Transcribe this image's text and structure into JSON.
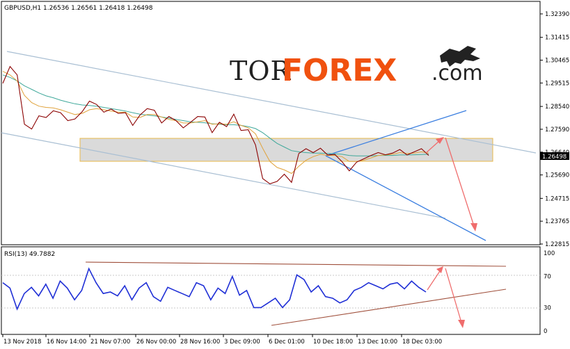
{
  "chart_data": [
    {
      "type": "line",
      "kind": "candlestick-price",
      "symbol": "GBPUSD,H1",
      "ohlc": {
        "open": "1.26536",
        "high": "1.26561",
        "low": "1.26418",
        "close": "1.26498"
      },
      "current_price_label": "1.26498",
      "y_ticks": [
        "1.32390",
        "1.31415",
        "1.30465",
        "1.29515",
        "1.28540",
        "1.27590",
        "1.26640",
        "1.25690",
        "1.24715",
        "1.23765",
        "1.22815"
      ],
      "ylim": [
        1.22815,
        1.3239
      ],
      "x_ticks": [
        "13 Nov 2018",
        "16 Nov 14:00",
        "21 Nov 07:00",
        "26 Nov 00:00",
        "28 Nov 16:00",
        "3 Dec 09:00",
        "6 Dec 01:00",
        "10 Dec 18:00",
        "13 Dec 10:00",
        "18 Dec 03:00"
      ],
      "grid": false,
      "series": [
        {
          "values": [
            1.295,
            1.302,
            1.2985,
            1.278,
            1.276,
            1.2815,
            1.2808,
            1.2836,
            1.2828,
            1.2795,
            1.2802,
            1.2832,
            1.2876,
            1.2862,
            1.283,
            1.2843,
            1.2825,
            1.2828,
            1.2775,
            1.2818,
            1.2845,
            1.2838,
            1.2785,
            1.2812,
            1.2795,
            1.2765,
            1.2788,
            1.2812,
            1.281,
            1.2745,
            1.2788,
            1.277,
            1.2822,
            1.2754,
            1.2757,
            1.2694,
            1.2554,
            1.2532,
            1.2542,
            1.2572,
            1.2538,
            1.2658,
            1.2678,
            1.2662,
            1.268,
            1.2652,
            1.2654,
            1.2624,
            1.2586,
            1.2622,
            1.2636,
            1.265,
            1.2662,
            1.2653,
            1.266,
            1.2675,
            1.2652,
            1.2665,
            1.2678,
            1.265
          ]
        },
        {
          "values": [
            1.3,
            1.2985,
            1.296,
            1.29,
            1.287,
            1.2855,
            1.285,
            1.2848,
            1.284,
            1.283,
            1.282,
            1.2825,
            1.284,
            1.2845,
            1.284,
            1.2835,
            1.283,
            1.283,
            1.281,
            1.2808,
            1.282,
            1.282,
            1.281,
            1.28,
            1.2795,
            1.2785,
            1.2785,
            1.279,
            1.2795,
            1.278,
            1.2782,
            1.278,
            1.279,
            1.2775,
            1.2765,
            1.274,
            1.268,
            1.2625,
            1.26,
            1.259,
            1.2575,
            1.2605,
            1.263,
            1.2645,
            1.2655,
            1.265,
            1.265,
            1.2645,
            1.2625,
            1.2625,
            1.263,
            1.264,
            1.265,
            1.2652,
            1.2655,
            1.2662,
            1.2658,
            1.266,
            1.2665,
            1.266
          ]
        },
        {
          "values": [
            1.2985,
            1.2975,
            1.296,
            1.294,
            1.2925,
            1.291,
            1.2898,
            1.289,
            1.288,
            1.2872,
            1.2865,
            1.286,
            1.2858,
            1.2855,
            1.285,
            1.2845,
            1.284,
            1.2835,
            1.2828,
            1.2822,
            1.2818,
            1.2815,
            1.281,
            1.2805,
            1.28,
            1.2795,
            1.279,
            1.2788,
            1.2786,
            1.2782,
            1.278,
            1.2778,
            1.2778,
            1.2775,
            1.277,
            1.2762,
            1.2745,
            1.2722,
            1.27,
            1.2685,
            1.267,
            1.2665,
            1.2662,
            1.266,
            1.266,
            1.2658,
            1.2657,
            1.2655,
            1.265,
            1.2648,
            1.2648,
            1.2648,
            1.265,
            1.265,
            1.265,
            1.2652,
            1.2652,
            1.2653,
            1.2654,
            1.2655
          ]
        }
      ]
    },
    {
      "type": "line",
      "title": "RSI(13) 49.7882",
      "y_ticks": [
        "100",
        "70",
        "30",
        "0"
      ],
      "ylim": [
        0,
        100
      ],
      "series": [
        {
          "values": [
            62,
            55,
            28,
            48,
            56,
            45,
            60,
            42,
            64,
            55,
            40,
            52,
            80,
            62,
            48,
            50,
            45,
            58,
            40,
            55,
            62,
            44,
            38,
            56,
            52,
            48,
            44,
            62,
            58,
            40,
            55,
            48,
            70,
            46,
            52,
            30,
            30,
            36,
            42,
            30,
            40,
            72,
            66,
            50,
            58,
            44,
            42,
            36,
            40,
            52,
            56,
            62,
            58,
            54,
            60,
            62,
            54,
            64,
            56,
            50
          ]
        }
      ]
    }
  ],
  "logo": {
    "tor": "TOR",
    "forex": "FOREX",
    "com": ".com"
  }
}
